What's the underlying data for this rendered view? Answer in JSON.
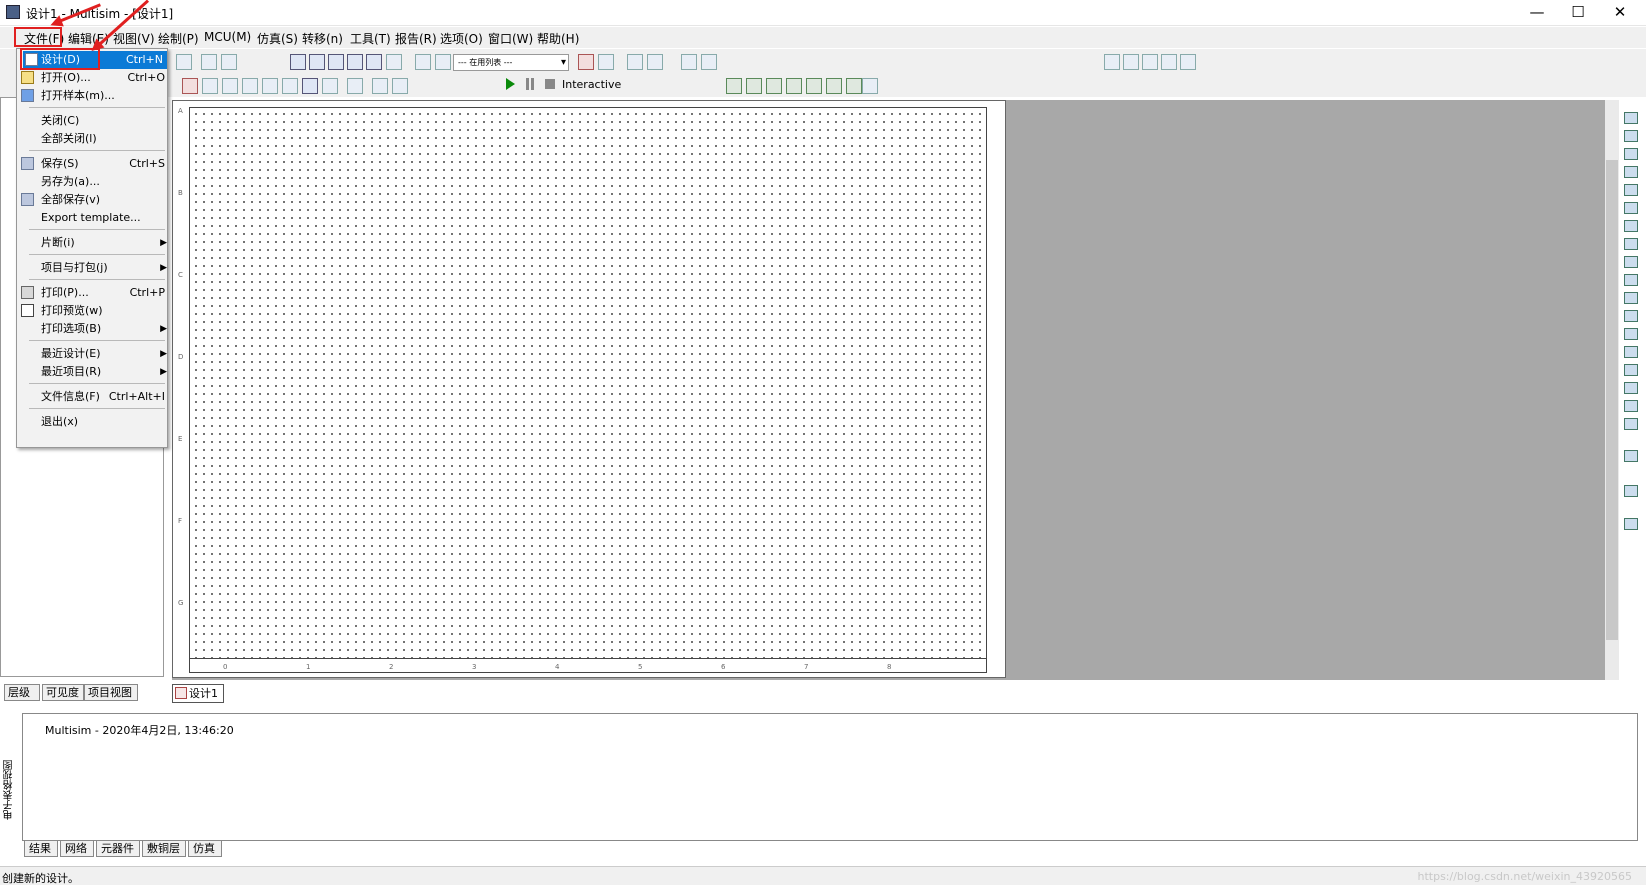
{
  "window": {
    "title": "设计1 - Multisim - [设计1]",
    "minimize": "—",
    "maximize": "☐",
    "close": "✕"
  },
  "menubar": [
    "文件(F)",
    "编辑(E)",
    "视图(V)",
    "绘制(P)",
    "MCU(M)",
    "仿真(S)",
    "转移(n)",
    "工具(T)",
    "报告(R)",
    "选项(O)",
    "窗口(W)",
    "帮助(H)"
  ],
  "toolbar": {
    "component_list_placeholder": "--- 在用列表 ---",
    "sim_mode": "Interactive"
  },
  "file_menu": [
    {
      "label": "设计(D)",
      "shortcut": "Ctrl+N",
      "highlighted": true,
      "icon": "new-doc-icon"
    },
    {
      "label": "打开(O)...",
      "shortcut": "Ctrl+O",
      "icon": "open-folder-icon"
    },
    {
      "label": "打开样本(m)...",
      "shortcut": "",
      "icon": "open-sample-icon"
    },
    {
      "label": "关闭(C)",
      "shortcut": ""
    },
    {
      "label": "全部关闭(l)",
      "shortcut": ""
    },
    {
      "label": "保存(S)",
      "shortcut": "Ctrl+S",
      "icon": "save-icon"
    },
    {
      "label": "另存为(a)...",
      "shortcut": ""
    },
    {
      "label": "全部保存(v)",
      "shortcut": "",
      "icon": "save-all-icon"
    },
    {
      "label": "Export template...",
      "shortcut": ""
    },
    {
      "label": "片断(i)",
      "shortcut": "",
      "submenu": true
    },
    {
      "label": "项目与打包(j)",
      "shortcut": "",
      "submenu": true
    },
    {
      "label": "打印(P)...",
      "shortcut": "Ctrl+P",
      "icon": "print-icon"
    },
    {
      "label": "打印预览(w)",
      "shortcut": "",
      "icon": "print-preview-icon"
    },
    {
      "label": "打印选项(B)",
      "shortcut": "",
      "submenu": true
    },
    {
      "label": "最近设计(E)",
      "shortcut": "",
      "submenu": true
    },
    {
      "label": "最近项目(R)",
      "shortcut": "",
      "submenu": true
    },
    {
      "label": "文件信息(F)",
      "shortcut": "Ctrl+Alt+I"
    },
    {
      "label": "退出(x)",
      "shortcut": ""
    }
  ],
  "left_panel": {
    "tabs": [
      "层级",
      "可见度",
      "项目视图"
    ]
  },
  "canvas": {
    "row_labels": [
      "A",
      "B",
      "C",
      "D",
      "E",
      "F",
      "G"
    ],
    "col_labels": [
      "0",
      "1",
      "2",
      "3",
      "4",
      "5",
      "6",
      "7",
      "8"
    ]
  },
  "doc_tab": "设计1",
  "output": {
    "line": "Multisim  -  2020年4月2日, 13:46:20",
    "side_label": "电子表格视图",
    "tabs": [
      "结果",
      "网络",
      "元器件",
      "敷铜层",
      "仿真"
    ]
  },
  "status": {
    "text": "创建新的设计。",
    "watermark": "https://blog.csdn.net/weixin_43920565"
  },
  "colors": {
    "highlight": "#0b7ad6",
    "annotation": "#e02020",
    "workspace_bg": "#a8a8a8"
  }
}
